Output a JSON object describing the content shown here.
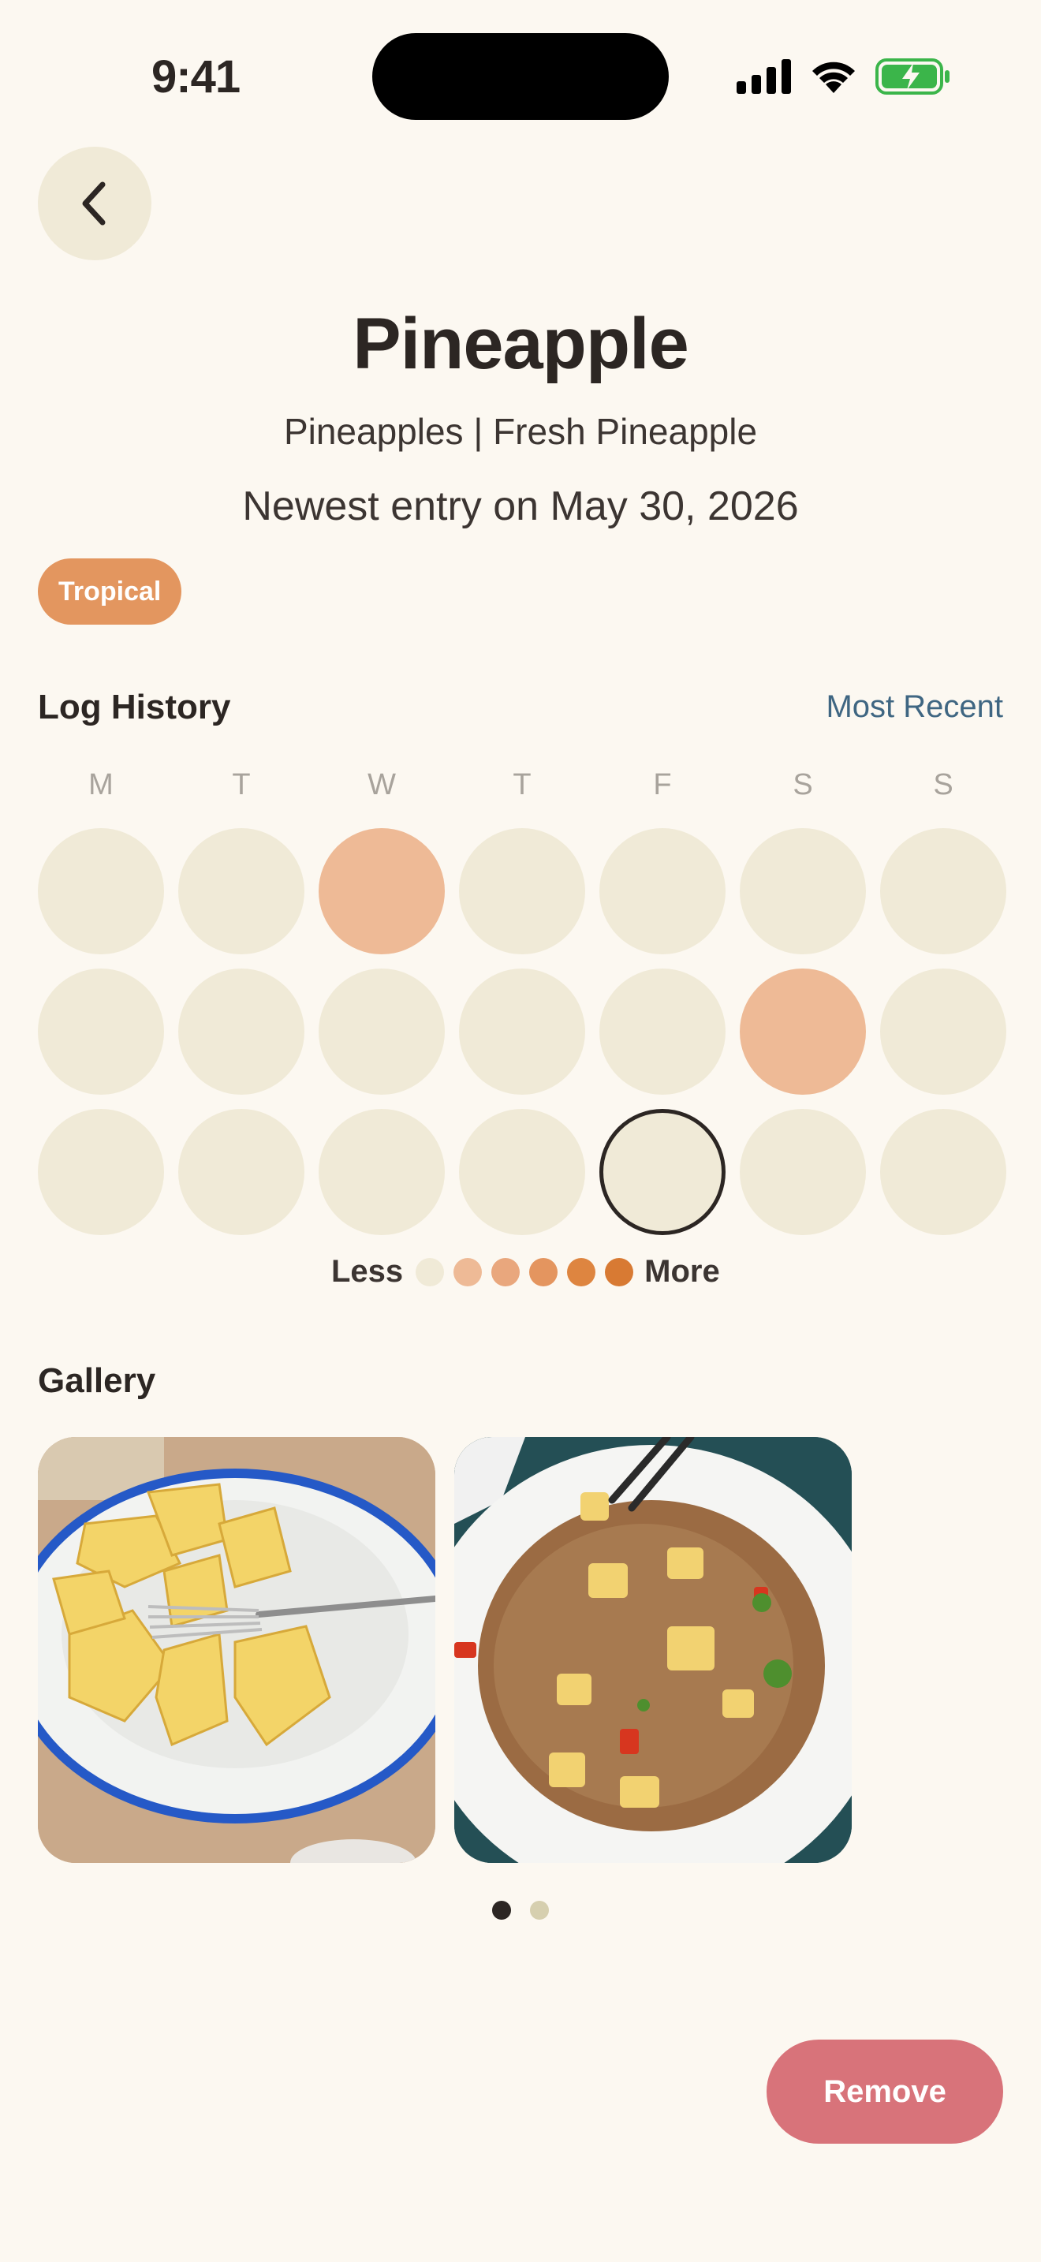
{
  "status_bar": {
    "time": "9:41"
  },
  "header": {
    "back_icon": "chevron-left-icon",
    "title": "Pineapple",
    "subtitle": "Pineapples | Fresh Pineapple",
    "newest_entry": "Newest entry on May 30, 2026",
    "tag": "Tropical"
  },
  "log_history": {
    "title": "Log History",
    "sort_label": "Most Recent",
    "days": [
      "M",
      "T",
      "W",
      "T",
      "F",
      "S",
      "S"
    ],
    "grid": [
      [
        0,
        0,
        1,
        0,
        0,
        0,
        0
      ],
      [
        0,
        0,
        0,
        0,
        0,
        1,
        0
      ],
      [
        0,
        0,
        0,
        0,
        0,
        0,
        0
      ]
    ],
    "today": {
      "row": 2,
      "col": 4
    },
    "legend": {
      "less": "Less",
      "more": "More",
      "colors": [
        "#F0EAD7",
        "#EEBA96",
        "#E9A77D",
        "#E4955F",
        "#DE8540",
        "#D87A33"
      ]
    }
  },
  "gallery": {
    "title": "Gallery",
    "photos": [
      "pineapple-chunks-plate",
      "pineapple-fried-rice-plate"
    ],
    "page_count": 2,
    "current_page": 1
  },
  "actions": {
    "remove_label": "Remove"
  },
  "colors": {
    "background": "#FCF8F1",
    "empty_cell": "#F0EAD7",
    "logged_cell": "#EEBA96",
    "tag": "#E3965F",
    "remove": "#D8737A",
    "link": "#3F6682"
  }
}
